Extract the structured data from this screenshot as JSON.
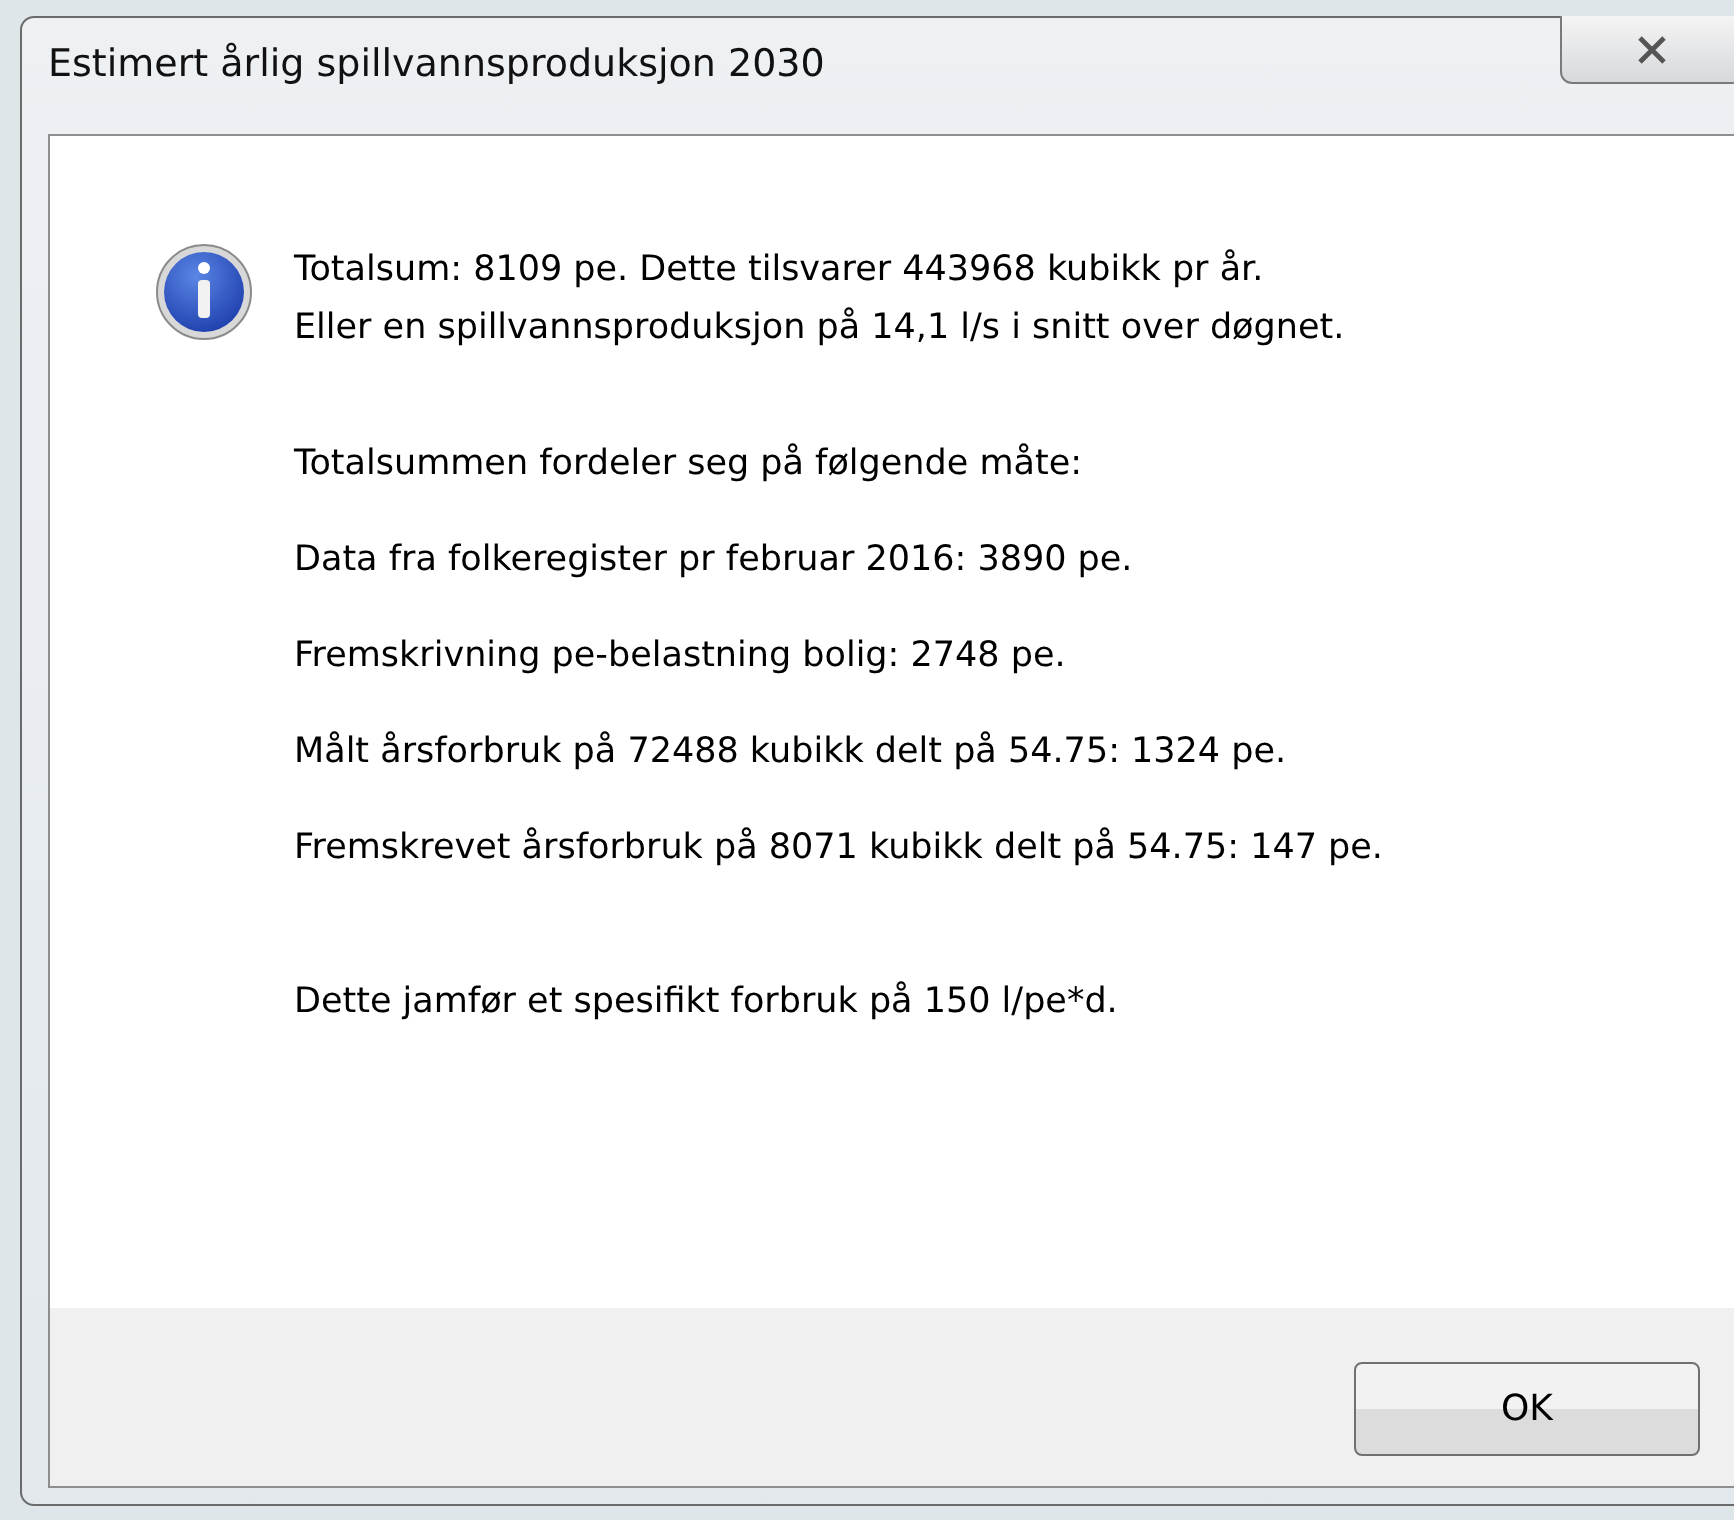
{
  "window": {
    "title": "Estimert årlig spillvannsproduksjon 2030"
  },
  "message": {
    "summary": [
      "Totalsum: 8109 pe. Dette tilsvarer 443968 kubikk pr år.",
      "Eller en spillvannsproduksjon på 14,1 l/s i snitt over døgnet."
    ],
    "heading": "Totalsummen fordeler seg på følgende måte:",
    "items": [
      "Data fra folkeregister pr februar 2016: 3890 pe.",
      "Fremskrivning pe-belastning bolig: 2748 pe.",
      "Målt årsforbruk på 72488 kubikk delt på 54.75: 1324 pe.",
      "Fremskrevet årsforbruk på 8071 kubikk delt på 54.75: 147 pe."
    ],
    "note": "Dette jamfør et spesifikt forbruk på 150 l/pe*d."
  },
  "buttons": [
    "OK"
  ]
}
